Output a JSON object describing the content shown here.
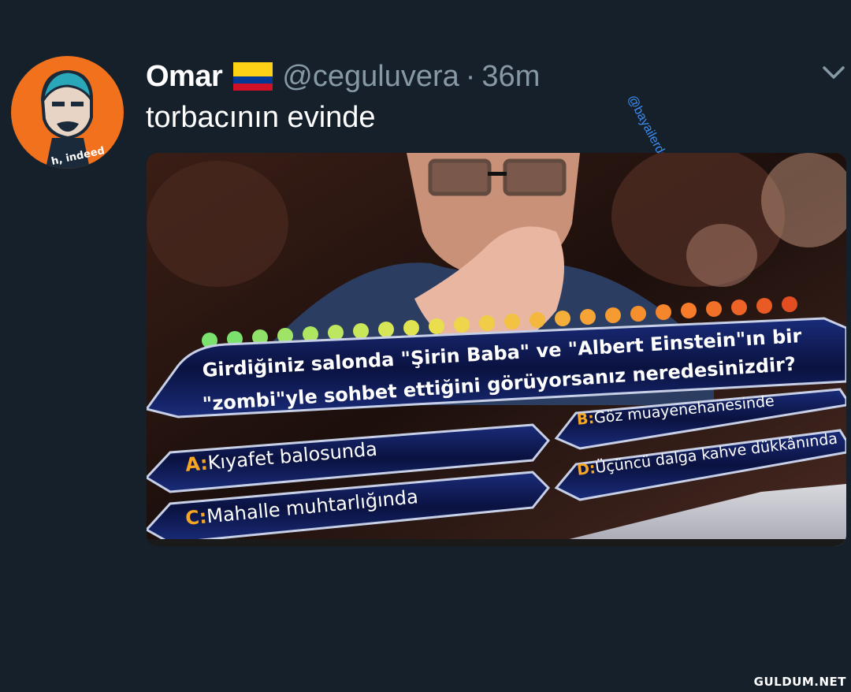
{
  "tweet": {
    "author_name": "Omar",
    "handle": "@ceguluvera",
    "separator": "·",
    "time": "36m",
    "text": "torbacının evinde",
    "avatar_caption": "h, indeed"
  },
  "watermarks": {
    "top": "@bayailerdesin",
    "bottom": "GULDUM.NET"
  },
  "quiz": {
    "question_line1": "Girdiğiniz salonda \"Şirin Baba\" ve \"Albert Einstein\"ın bir",
    "question_line2": "\"zombi\"yle sohbet ettiğini görüyorsanız neredesinizdir?",
    "answers": [
      {
        "letter": "A:",
        "text": "Kıyafet balosunda"
      },
      {
        "letter": "B:",
        "text": "Göz muayenehanesinde"
      },
      {
        "letter": "C:",
        "text": "Mahalle muhtarlığında"
      },
      {
        "letter": "D:",
        "text": "Üçüncü dalga kahve dükkânında"
      }
    ]
  },
  "icons": {
    "flag": "colombia-flag-icon",
    "chevron": "chevron-down-icon"
  },
  "colors": {
    "background": "#15202b",
    "muted_text": "#8899a6",
    "avatar_bg": "#f2711c",
    "answer_letter": "#f6a623"
  }
}
